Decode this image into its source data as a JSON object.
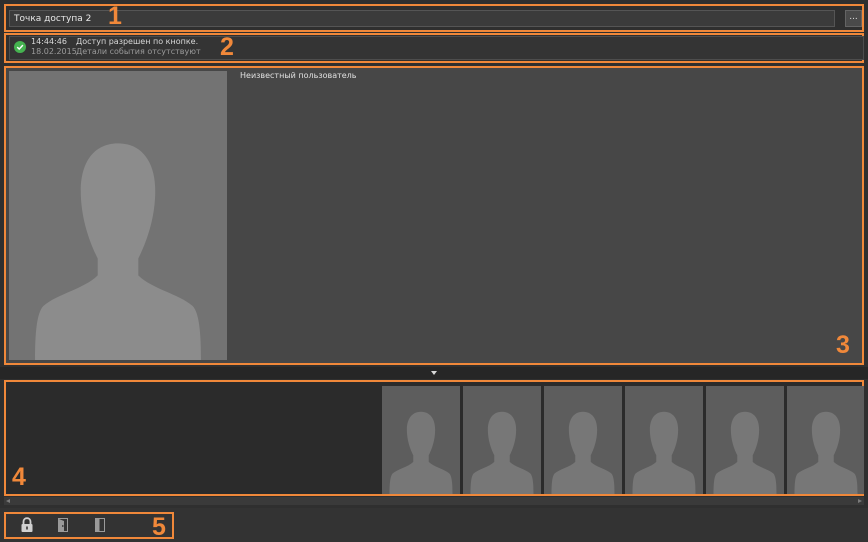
{
  "access_point": {
    "name": "Точка доступа 2",
    "browse_button": "..."
  },
  "event": {
    "status_icon": "check-circle-icon",
    "time": "14:44:46",
    "date": "18.02.2015",
    "message": "Доступ разрешен по кнопке.",
    "details": "Детали события отсутствуют"
  },
  "person": {
    "name": "Неизвестный пользователь",
    "photo_icon": "person-silhouette-icon"
  },
  "history": {
    "thumbnails": [
      {
        "icon": "person-silhouette-icon"
      },
      {
        "icon": "person-silhouette-icon"
      },
      {
        "icon": "person-silhouette-icon"
      },
      {
        "icon": "person-silhouette-icon"
      },
      {
        "icon": "person-silhouette-icon"
      },
      {
        "icon": "person-silhouette-icon"
      }
    ]
  },
  "toolbar": {
    "buttons": [
      {
        "icon": "lock-icon"
      },
      {
        "icon": "door-open-icon"
      },
      {
        "icon": "door-closed-icon"
      }
    ]
  },
  "callouts": [
    "1",
    "2",
    "3",
    "4",
    "5"
  ],
  "colors": {
    "callout_accent": "#f0883a",
    "status_ok": "#45b350",
    "panel_bg": "#474747",
    "photo_bg": "#737373"
  }
}
